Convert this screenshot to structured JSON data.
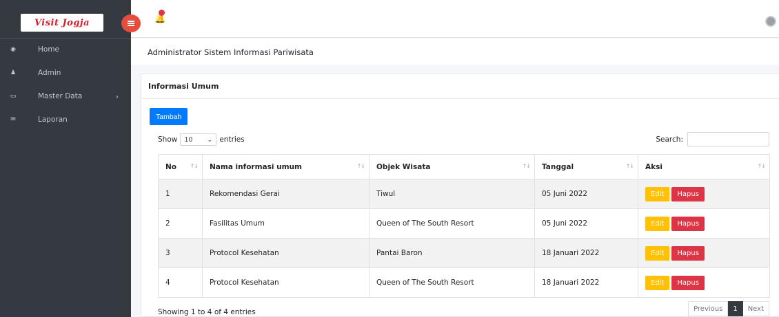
{
  "brand": {
    "logo_text": "Visit Jogja"
  },
  "sidebar": {
    "items": [
      {
        "label": "Home",
        "icon": "dashboard-icon"
      },
      {
        "label": "Admin",
        "icon": "users-icon"
      },
      {
        "label": "Master Data",
        "icon": "laptop-icon",
        "has_submenu": true
      },
      {
        "label": "Laporan",
        "icon": "envelope-icon"
      }
    ]
  },
  "topbar": {
    "notification_count_indicator": true
  },
  "header": {
    "title": "Administrator Sistem Informasi Pariwisata"
  },
  "card": {
    "title": "Informasi Umum",
    "add_button": "Tambah",
    "length": {
      "show": "Show",
      "value": "10",
      "entries": "entries"
    },
    "search_label": "Search:",
    "columns": [
      "No",
      "Nama informasi umum",
      "Objek Wisata",
      "Tanggal",
      "Aksi"
    ],
    "rows": [
      {
        "no": "1",
        "nama": "Rekomendasi Gerai",
        "objek": "Tiwul",
        "tanggal": "05 Juni 2022"
      },
      {
        "no": "2",
        "nama": "Fasilitas Umum",
        "objek": "Queen of The South Resort",
        "tanggal": "05 Juni 2022"
      },
      {
        "no": "3",
        "nama": "Protocol Kesehatan",
        "objek": "Pantai Baron",
        "tanggal": "18 Januari 2022"
      },
      {
        "no": "4",
        "nama": "Protocol Kesehatan",
        "objek": "Queen of The South Resort",
        "tanggal": "18 Januari 2022"
      }
    ],
    "edit_label": "Edit",
    "delete_label": "Hapus",
    "info": "Showing 1 to 4 of 4 entries",
    "pager": {
      "previous": "Previous",
      "current": "1",
      "next": "Next"
    }
  },
  "colors": {
    "sidebar": "#343a40",
    "primary": "#007bff",
    "warning": "#ffc107",
    "danger": "#dc3545",
    "toggle": "#e74c3c"
  }
}
